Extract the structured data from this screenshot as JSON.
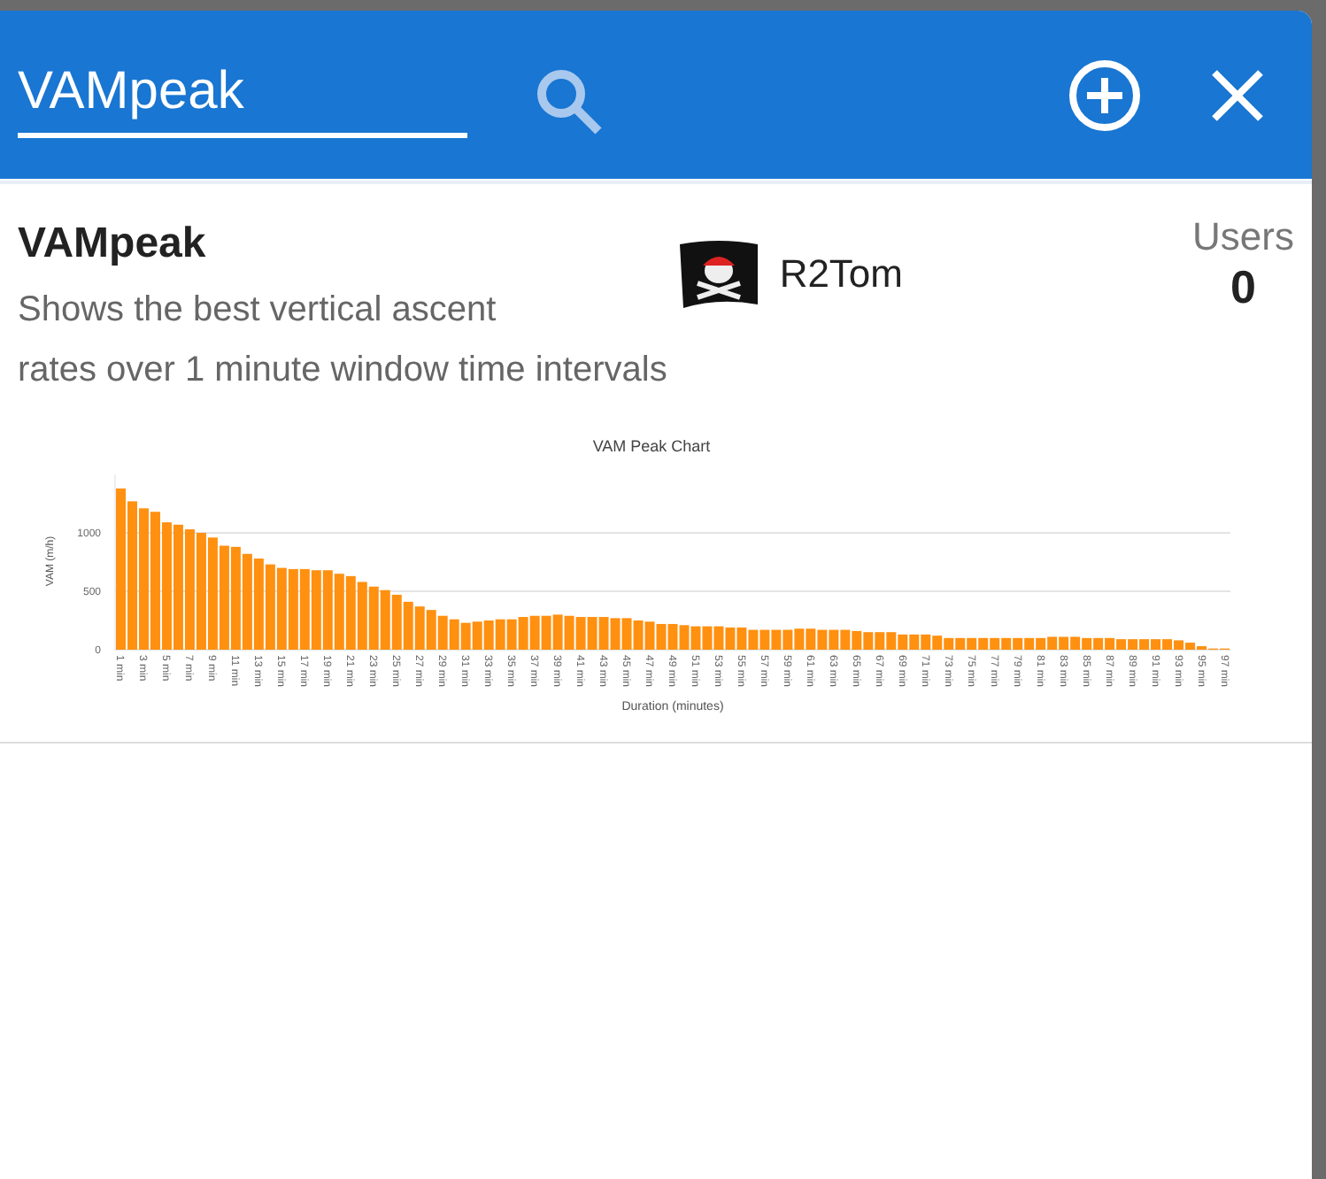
{
  "search": {
    "value": "VAMpeak"
  },
  "item": {
    "title": "VAMpeak",
    "description": "Shows the best vertical ascent rates over 1 minute window time intervals",
    "author": "R2Tom",
    "users_label": "Users",
    "users_count": "0",
    "chart_data": {
      "type": "bar",
      "title": "VAM Peak Chart",
      "xlabel": "Duration (minutes)",
      "ylabel": "VAM (m/h)",
      "x": [
        1,
        2,
        3,
        4,
        5,
        6,
        7,
        8,
        9,
        10,
        11,
        12,
        13,
        14,
        15,
        16,
        17,
        18,
        19,
        20,
        21,
        22,
        23,
        24,
        25,
        26,
        27,
        28,
        29,
        30,
        31,
        32,
        33,
        34,
        35,
        36,
        37,
        38,
        39,
        40,
        41,
        42,
        43,
        44,
        45,
        46,
        47,
        48,
        49,
        50,
        51,
        52,
        53,
        54,
        55,
        56,
        57,
        58,
        59,
        60,
        61,
        62,
        63,
        64,
        65,
        66,
        67,
        68,
        69,
        70,
        71,
        72,
        73,
        74,
        75,
        76,
        77,
        78,
        79,
        80,
        81,
        82,
        83,
        84,
        85,
        86,
        87,
        88,
        89,
        90,
        91,
        92,
        93,
        94,
        95,
        96,
        97
      ],
      "series": [
        {
          "color": "#ff9010",
          "values": [
            1380,
            1270,
            1210,
            1180,
            1090,
            1070,
            1030,
            1000,
            960,
            890,
            880,
            820,
            780,
            730,
            700,
            690,
            690,
            680,
            680,
            650,
            630,
            580,
            540,
            510,
            470,
            410,
            370,
            340,
            290,
            260,
            230,
            240,
            250,
            260,
            260,
            280,
            290,
            290,
            300,
            290,
            280,
            280,
            280,
            270,
            270,
            250,
            240,
            220,
            220,
            210,
            200,
            200,
            200,
            190,
            190,
            170,
            170,
            170,
            170,
            180,
            180,
            170,
            170,
            170,
            160,
            150,
            150,
            150,
            130,
            130,
            130,
            120,
            100,
            100,
            100,
            100,
            100,
            100,
            100,
            100,
            100,
            110,
            110,
            110,
            100,
            100,
            100,
            90,
            90,
            90,
            90,
            90,
            80,
            60,
            30,
            10,
            10
          ]
        }
      ],
      "xlim": [
        0.5,
        97.5
      ],
      "ylim": [
        0,
        1500
      ],
      "yticks": [
        0,
        500,
        1000
      ],
      "xticks": [
        {
          "value": 1,
          "label": "1 min"
        },
        {
          "value": 3,
          "label": "3 min"
        },
        {
          "value": 5,
          "label": "5 min"
        },
        {
          "value": 7,
          "label": "7 min"
        },
        {
          "value": 9,
          "label": "9 min"
        },
        {
          "value": 11,
          "label": "11 min"
        },
        {
          "value": 13,
          "label": "13 min"
        },
        {
          "value": 15,
          "label": "15 min"
        },
        {
          "value": 17,
          "label": "17 min"
        },
        {
          "value": 19,
          "label": "19 min"
        },
        {
          "value": 21,
          "label": "21 min"
        },
        {
          "value": 23,
          "label": "23 min"
        },
        {
          "value": 25,
          "label": "25 min"
        },
        {
          "value": 27,
          "label": "27 min"
        },
        {
          "value": 29,
          "label": "29 min"
        },
        {
          "value": 31,
          "label": "31 min"
        },
        {
          "value": 33,
          "label": "33 min"
        },
        {
          "value": 35,
          "label": "35 min"
        },
        {
          "value": 37,
          "label": "37 min"
        },
        {
          "value": 39,
          "label": "39 min"
        },
        {
          "value": 41,
          "label": "41 min"
        },
        {
          "value": 43,
          "label": "43 min"
        },
        {
          "value": 45,
          "label": "45 min"
        },
        {
          "value": 47,
          "label": "47 min"
        },
        {
          "value": 49,
          "label": "49 min"
        },
        {
          "value": 51,
          "label": "51 min"
        },
        {
          "value": 53,
          "label": "53 min"
        },
        {
          "value": 55,
          "label": "55 min"
        },
        {
          "value": 57,
          "label": "57 min"
        },
        {
          "value": 59,
          "label": "59 min"
        },
        {
          "value": 61,
          "label": "61 min"
        },
        {
          "value": 63,
          "label": "63 min"
        },
        {
          "value": 65,
          "label": "65 min"
        },
        {
          "value": 67,
          "label": "67 min"
        },
        {
          "value": 69,
          "label": "69 min"
        },
        {
          "value": 71,
          "label": "71 min"
        },
        {
          "value": 73,
          "label": "73 min"
        },
        {
          "value": 75,
          "label": "75 min"
        },
        {
          "value": 77,
          "label": "77 min"
        },
        {
          "value": 79,
          "label": "79 min"
        },
        {
          "value": 81,
          "label": "81 min"
        },
        {
          "value": 83,
          "label": "83 min"
        },
        {
          "value": 85,
          "label": "85 min"
        },
        {
          "value": 87,
          "label": "87 min"
        },
        {
          "value": 89,
          "label": "89 min"
        },
        {
          "value": 91,
          "label": "91 min"
        },
        {
          "value": 93,
          "label": "93 min"
        },
        {
          "value": 95,
          "label": "95 min"
        },
        {
          "value": 97,
          "label": "97 min"
        }
      ]
    }
  }
}
